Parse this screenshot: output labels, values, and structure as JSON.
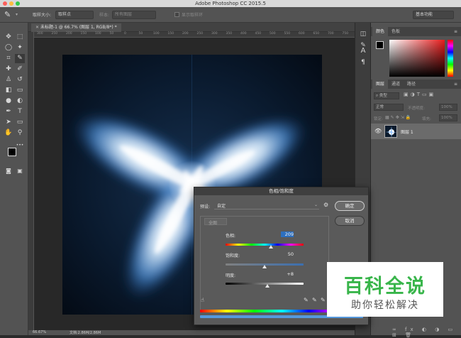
{
  "window": {
    "title": "Adobe Photoshop CC 2015.5"
  },
  "options_bar": {
    "sample_size_label": "取样大小:",
    "sample_size_value": "取样点",
    "sample_label": "样本:",
    "sample_value": "所有图层",
    "show_ring_label": "显示取样环",
    "workspace_value": "基本功能"
  },
  "document": {
    "tab_label": "未标题-1 @ 66.7% (图层 1, RGB/8*) *",
    "ruler_ticks": [
      "300",
      "250",
      "200",
      "150",
      "100",
      "50",
      "0",
      "50",
      "100",
      "150",
      "200",
      "250",
      "300",
      "350",
      "400",
      "450",
      "500",
      "550",
      "600",
      "650",
      "700",
      "750"
    ]
  },
  "status": {
    "zoom": "66.67%",
    "doc_size": "文档:2.86M/2.86M"
  },
  "colors": {
    "accent": "#2d8cf0",
    "watermark_green": "#38b54a",
    "canvas_bg": "#06101d"
  },
  "panels": {
    "color_tabs": [
      "颜色",
      "色板"
    ],
    "layers_tabs": [
      "图层",
      "通道",
      "路径"
    ],
    "kind_filter": "类型",
    "blend_mode": "正常",
    "opacity_label": "不透明度:",
    "opacity_value": "100%",
    "lock_label": "锁定:",
    "fill_label": "填充:",
    "fill_value": "100%",
    "layer_name": "图层 1"
  },
  "dialog": {
    "title": "色相/饱和度",
    "preset_label": "预设:",
    "preset_value": "自定",
    "channel_value": "全图",
    "ok_label": "确定",
    "cancel_label": "取消",
    "hue_label": "色相:",
    "hue_value": "209",
    "hue_fraction": 0.58,
    "saturation_label": "饱和度:",
    "saturation_value": "50",
    "saturation_fraction": 0.5,
    "lightness_label": "明度:",
    "lightness_value": "+8",
    "lightness_fraction": 0.54
  },
  "watermark": {
    "title": "百科全说",
    "subtitle": "助你轻松解决"
  }
}
